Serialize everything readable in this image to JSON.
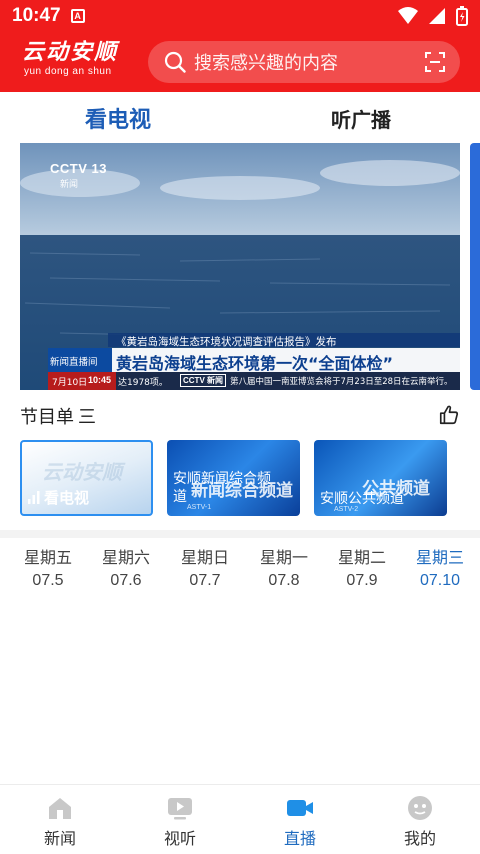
{
  "status_bar": {
    "time": "10:47",
    "notif_letter": "A"
  },
  "header": {
    "logo_text": "云动安顺",
    "logo_pinyin": "yun dong an shun",
    "search_placeholder": "搜索感兴趣的内容"
  },
  "tabs": {
    "tv": "看电视",
    "radio": "听广播"
  },
  "video": {
    "channel_logo": "CCTV 13",
    "channel_sub": "新闻",
    "report_title": "《黄岩岛海域生态环境状况调查评估报告》发布",
    "headline": "黄岩岛海域生态环境第一次“全面体检”",
    "show_name": "新闻直播间",
    "date": "7月10日",
    "time": "10:45",
    "ticker_left": "达1978项。",
    "ticker_logo": "CCTV 新闻",
    "ticker_right": "第八届中国一南亚博览会将于7月23日至28日在云南举行。"
  },
  "guide": {
    "title": "节目单",
    "menu_glyph": "三"
  },
  "channels": [
    {
      "label": "看电视",
      "watermark": "云动安顺"
    },
    {
      "line1": "安顺新闻综合频",
      "line2": "道",
      "big": "新闻综合频道",
      "sub": "ASTV-1"
    },
    {
      "line1": "安顺公共频道",
      "big": "公共频道",
      "sub": "ASTV-2"
    }
  ],
  "days": [
    {
      "name": "星期五",
      "date": "07.5",
      "active": false
    },
    {
      "name": "星期六",
      "date": "07.6",
      "active": false
    },
    {
      "name": "星期日",
      "date": "07.7",
      "active": false
    },
    {
      "name": "星期一",
      "date": "07.8",
      "active": false
    },
    {
      "name": "星期二",
      "date": "07.9",
      "active": false
    },
    {
      "name": "星期三",
      "date": "07.10",
      "active": true
    }
  ],
  "bottom_nav": [
    {
      "label": "新闻",
      "icon": "home-icon"
    },
    {
      "label": "视听",
      "icon": "play-icon"
    },
    {
      "label": "直播",
      "icon": "video-camera-icon"
    },
    {
      "label": "我的",
      "icon": "profile-icon"
    }
  ],
  "colors": {
    "brand_red": "#ef1c1c",
    "active_blue": "#1f6bbf"
  }
}
